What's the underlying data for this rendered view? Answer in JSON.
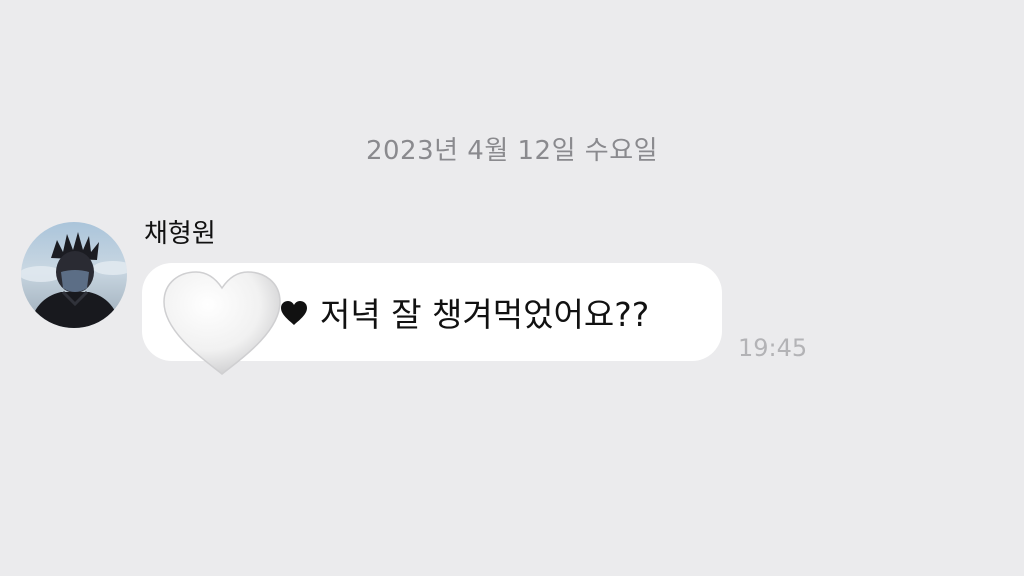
{
  "chat": {
    "date": "2023년 4월 12일 수요일",
    "message": {
      "sender": "채형원",
      "avatar": "profile-photo",
      "emoji": [
        "white-heart-icon",
        "black-heart-icon"
      ],
      "text": "저녁 잘 챙겨먹었어요??",
      "time": "19:45"
    }
  },
  "colors": {
    "background": "#ebebed",
    "bubble": "#ffffff",
    "date_text": "#8a8a8e",
    "timestamp_text": "#b3b3b6"
  }
}
